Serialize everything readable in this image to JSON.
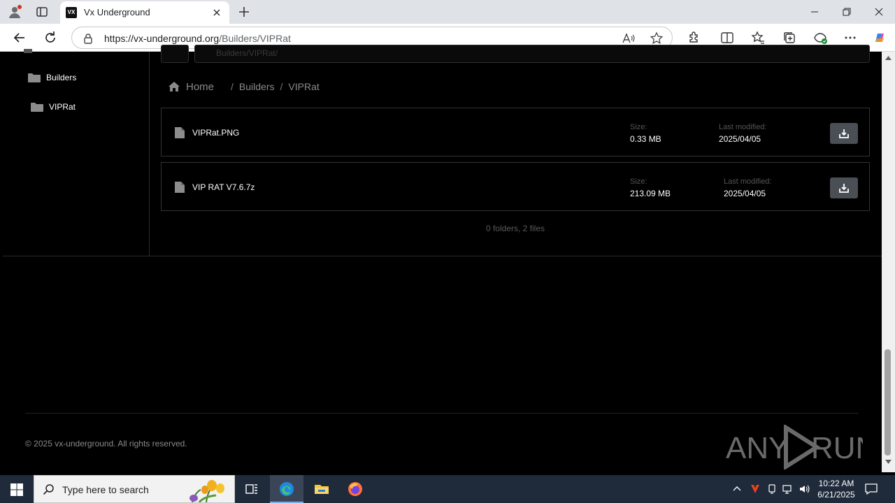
{
  "browser": {
    "tab_title": "Vx Underground",
    "favicon_text": "VX",
    "url_host": "https://vx-underground.org",
    "url_path": "/Builders/VIPRat"
  },
  "sidebar": {
    "items": [
      {
        "label": "Builders"
      },
      {
        "label": "VIPRat"
      }
    ]
  },
  "search": {
    "placeholder": "Builders/VIPRat/"
  },
  "breadcrumb": {
    "home": "Home",
    "separator": "/",
    "crumbs": [
      "Builders",
      "VIPRat"
    ]
  },
  "files": [
    {
      "name": "VIPRat.PNG",
      "size_label": "Size:",
      "size": "0.33 MB",
      "modified_label": "Last modified:",
      "modified": "2025/04/05"
    },
    {
      "name": "VIP RAT V7.6.7z",
      "size_label": "Size:",
      "size": "213.09 MB",
      "modified_label": "Last modified:",
      "modified": "2025/04/05"
    }
  ],
  "summary": "0 folders, 2 files",
  "footer": {
    "copyright": "© 2025 vx-underground. All rights reserved."
  },
  "watermark": {
    "left": "ANY",
    "right": "RUN"
  },
  "taskbar": {
    "search_placeholder": "Type here to search",
    "time": "10:22 AM",
    "date": "6/21/2025"
  },
  "colors": {
    "page_bg": "#000000",
    "download_btn": "#4a4f55",
    "taskbar_bg": "#1f2a3a"
  }
}
